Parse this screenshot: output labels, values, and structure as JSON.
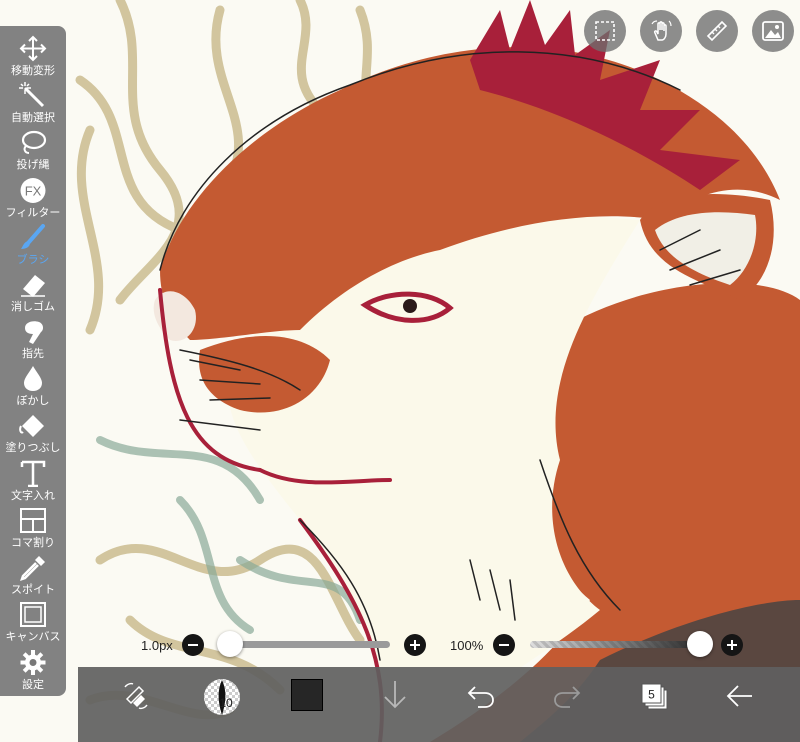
{
  "toolbar": {
    "items": [
      {
        "label": "移動変形",
        "icon": "move-icon"
      },
      {
        "label": "自動選択",
        "icon": "magic-wand-icon"
      },
      {
        "label": "投げ縄",
        "icon": "lasso-icon"
      },
      {
        "label": "フィルター",
        "icon": "fx-icon"
      },
      {
        "label": "ブラシ",
        "icon": "brush-icon",
        "active": true
      },
      {
        "label": "消しゴム",
        "icon": "eraser-icon"
      },
      {
        "label": "指先",
        "icon": "finger-icon"
      },
      {
        "label": "ぼかし",
        "icon": "blur-drop-icon"
      },
      {
        "label": "塗りつぶし",
        "icon": "fill-bucket-icon"
      },
      {
        "label": "文字入れ",
        "icon": "text-icon"
      },
      {
        "label": "コマ割り",
        "icon": "frame-divider-icon"
      },
      {
        "label": "スポイト",
        "icon": "eyedropper-icon"
      },
      {
        "label": "キャンバス",
        "icon": "canvas-icon"
      },
      {
        "label": "設定",
        "icon": "gear-icon"
      }
    ],
    "fx_text": "FX"
  },
  "top_buttons": [
    {
      "icon": "selection-icon"
    },
    {
      "icon": "hand-gesture-icon"
    },
    {
      "icon": "ruler-icon"
    },
    {
      "icon": "image-material-icon"
    }
  ],
  "brush_size": {
    "label": "1.0px",
    "value_fraction": 0.0
  },
  "brush_opacity": {
    "label": "100%",
    "value_fraction": 1.0
  },
  "bottom_bar": {
    "brush_preview_value": "10",
    "color_swatch": "#262626",
    "layer_count": "5"
  },
  "colors": {
    "accent": "#5aa6f2",
    "fur": "#c45a32",
    "outline": "#a8203a",
    "sketch": "#c8b98a",
    "sketch_green": "#8aaa98",
    "cream": "#fbf9ea"
  }
}
